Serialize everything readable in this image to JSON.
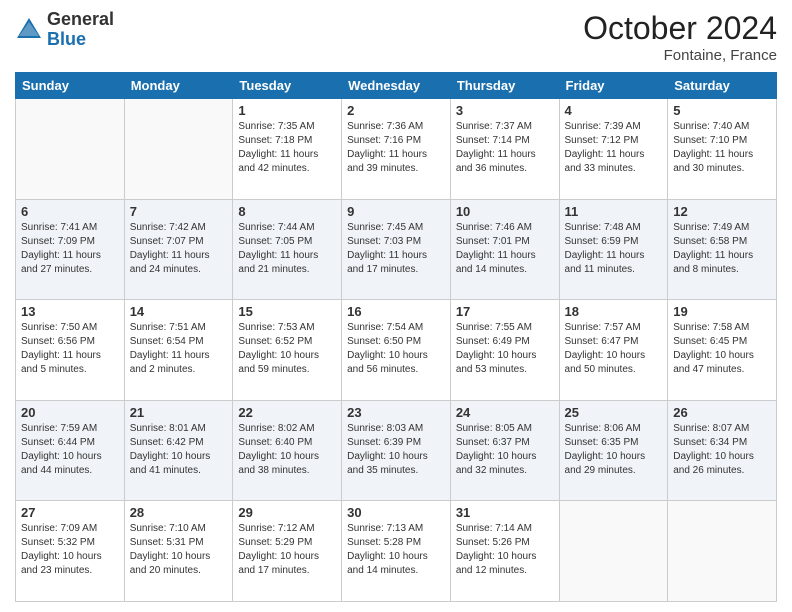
{
  "header": {
    "logo_general": "General",
    "logo_blue": "Blue",
    "month_title": "October 2024",
    "location": "Fontaine, France"
  },
  "days_of_week": [
    "Sunday",
    "Monday",
    "Tuesday",
    "Wednesday",
    "Thursday",
    "Friday",
    "Saturday"
  ],
  "weeks": [
    [
      {
        "day": "",
        "info": ""
      },
      {
        "day": "",
        "info": ""
      },
      {
        "day": "1",
        "info": "Sunrise: 7:35 AM\nSunset: 7:18 PM\nDaylight: 11 hours and 42 minutes."
      },
      {
        "day": "2",
        "info": "Sunrise: 7:36 AM\nSunset: 7:16 PM\nDaylight: 11 hours and 39 minutes."
      },
      {
        "day": "3",
        "info": "Sunrise: 7:37 AM\nSunset: 7:14 PM\nDaylight: 11 hours and 36 minutes."
      },
      {
        "day": "4",
        "info": "Sunrise: 7:39 AM\nSunset: 7:12 PM\nDaylight: 11 hours and 33 minutes."
      },
      {
        "day": "5",
        "info": "Sunrise: 7:40 AM\nSunset: 7:10 PM\nDaylight: 11 hours and 30 minutes."
      }
    ],
    [
      {
        "day": "6",
        "info": "Sunrise: 7:41 AM\nSunset: 7:09 PM\nDaylight: 11 hours and 27 minutes."
      },
      {
        "day": "7",
        "info": "Sunrise: 7:42 AM\nSunset: 7:07 PM\nDaylight: 11 hours and 24 minutes."
      },
      {
        "day": "8",
        "info": "Sunrise: 7:44 AM\nSunset: 7:05 PM\nDaylight: 11 hours and 21 minutes."
      },
      {
        "day": "9",
        "info": "Sunrise: 7:45 AM\nSunset: 7:03 PM\nDaylight: 11 hours and 17 minutes."
      },
      {
        "day": "10",
        "info": "Sunrise: 7:46 AM\nSunset: 7:01 PM\nDaylight: 11 hours and 14 minutes."
      },
      {
        "day": "11",
        "info": "Sunrise: 7:48 AM\nSunset: 6:59 PM\nDaylight: 11 hours and 11 minutes."
      },
      {
        "day": "12",
        "info": "Sunrise: 7:49 AM\nSunset: 6:58 PM\nDaylight: 11 hours and 8 minutes."
      }
    ],
    [
      {
        "day": "13",
        "info": "Sunrise: 7:50 AM\nSunset: 6:56 PM\nDaylight: 11 hours and 5 minutes."
      },
      {
        "day": "14",
        "info": "Sunrise: 7:51 AM\nSunset: 6:54 PM\nDaylight: 11 hours and 2 minutes."
      },
      {
        "day": "15",
        "info": "Sunrise: 7:53 AM\nSunset: 6:52 PM\nDaylight: 10 hours and 59 minutes."
      },
      {
        "day": "16",
        "info": "Sunrise: 7:54 AM\nSunset: 6:50 PM\nDaylight: 10 hours and 56 minutes."
      },
      {
        "day": "17",
        "info": "Sunrise: 7:55 AM\nSunset: 6:49 PM\nDaylight: 10 hours and 53 minutes."
      },
      {
        "day": "18",
        "info": "Sunrise: 7:57 AM\nSunset: 6:47 PM\nDaylight: 10 hours and 50 minutes."
      },
      {
        "day": "19",
        "info": "Sunrise: 7:58 AM\nSunset: 6:45 PM\nDaylight: 10 hours and 47 minutes."
      }
    ],
    [
      {
        "day": "20",
        "info": "Sunrise: 7:59 AM\nSunset: 6:44 PM\nDaylight: 10 hours and 44 minutes."
      },
      {
        "day": "21",
        "info": "Sunrise: 8:01 AM\nSunset: 6:42 PM\nDaylight: 10 hours and 41 minutes."
      },
      {
        "day": "22",
        "info": "Sunrise: 8:02 AM\nSunset: 6:40 PM\nDaylight: 10 hours and 38 minutes."
      },
      {
        "day": "23",
        "info": "Sunrise: 8:03 AM\nSunset: 6:39 PM\nDaylight: 10 hours and 35 minutes."
      },
      {
        "day": "24",
        "info": "Sunrise: 8:05 AM\nSunset: 6:37 PM\nDaylight: 10 hours and 32 minutes."
      },
      {
        "day": "25",
        "info": "Sunrise: 8:06 AM\nSunset: 6:35 PM\nDaylight: 10 hours and 29 minutes."
      },
      {
        "day": "26",
        "info": "Sunrise: 8:07 AM\nSunset: 6:34 PM\nDaylight: 10 hours and 26 minutes."
      }
    ],
    [
      {
        "day": "27",
        "info": "Sunrise: 7:09 AM\nSunset: 5:32 PM\nDaylight: 10 hours and 23 minutes."
      },
      {
        "day": "28",
        "info": "Sunrise: 7:10 AM\nSunset: 5:31 PM\nDaylight: 10 hours and 20 minutes."
      },
      {
        "day": "29",
        "info": "Sunrise: 7:12 AM\nSunset: 5:29 PM\nDaylight: 10 hours and 17 minutes."
      },
      {
        "day": "30",
        "info": "Sunrise: 7:13 AM\nSunset: 5:28 PM\nDaylight: 10 hours and 14 minutes."
      },
      {
        "day": "31",
        "info": "Sunrise: 7:14 AM\nSunset: 5:26 PM\nDaylight: 10 hours and 12 minutes."
      },
      {
        "day": "",
        "info": ""
      },
      {
        "day": "",
        "info": ""
      }
    ]
  ]
}
